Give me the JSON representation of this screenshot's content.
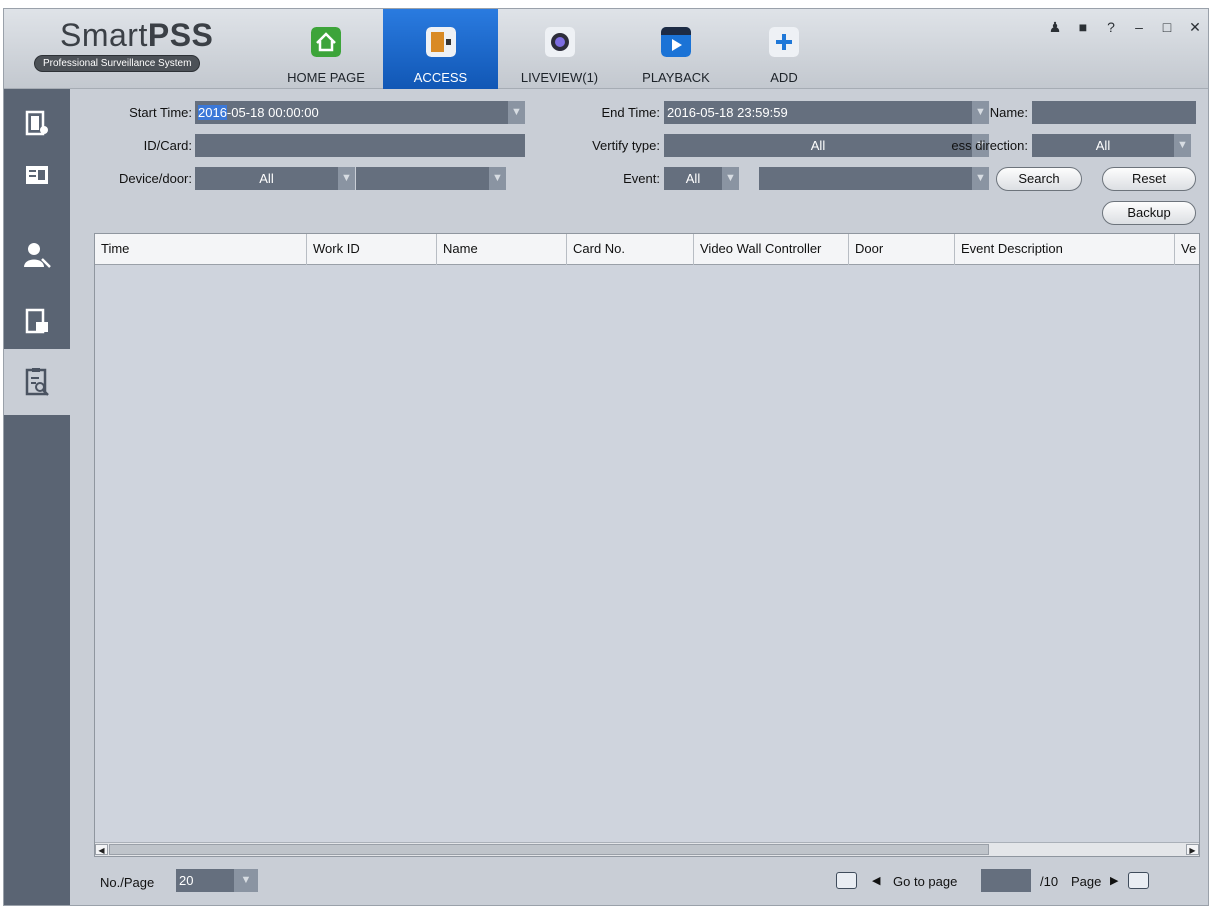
{
  "app": {
    "brand_light": "Smart",
    "brand_bold": "PSS",
    "tagline": "Professional Surveillance System"
  },
  "nav": {
    "home": "HOME PAGE",
    "access": "ACCESS",
    "liveview": "LIVEVIEW(1)",
    "playback": "PLAYBACK",
    "add": "ADD",
    "active": "ACCESS"
  },
  "window_controls": [
    "user-icon",
    "lock-icon",
    "help-icon",
    "minimize-icon",
    "maximize-icon",
    "close-icon"
  ],
  "sidebar": {
    "items": [
      "door-access-icon",
      "personnel-card-icon",
      "user-permission-icon",
      "door-config-icon",
      "log-search-icon"
    ],
    "active_index": 4
  },
  "filters": {
    "start_time_label": "Start Time:",
    "start_time_selected": "2016",
    "start_time_rest": "-05-18 00:00:00",
    "end_time_label": "End Time:",
    "end_time_value": "2016-05-18 23:59:59",
    "name_label": "Name:",
    "name_value": "",
    "id_card_label": "ID/Card:",
    "id_card_value": "",
    "verify_type_label": "Vertify type:",
    "verify_type_value": "All",
    "direction_label": "Access direction:",
    "direction_visible_label": "ess direction:",
    "direction_value": "All",
    "device_door_label": "Device/door:",
    "device_value": "All",
    "door_value": "",
    "event_label": "Event:",
    "event_value": "All",
    "event_detail_value": "",
    "search_label": "Search",
    "reset_label": "Reset",
    "backup_label": "Backup"
  },
  "table": {
    "columns": [
      "Time",
      "Work ID",
      "Name",
      "Card No.",
      "Video Wall Controller",
      "Door",
      "Event Description",
      "Ve"
    ],
    "rows": []
  },
  "pager": {
    "per_page_label": "No./Page",
    "per_page_value": "20",
    "goto_label": "Go to page",
    "page_input": "",
    "total_pages_text": "/10",
    "page_label": "Page"
  },
  "colors": {
    "accent": "#1b66c9",
    "field_bg": "#656f7e",
    "sidebar_bg": "#5a6473",
    "table_bg": "#cfd4dd"
  }
}
